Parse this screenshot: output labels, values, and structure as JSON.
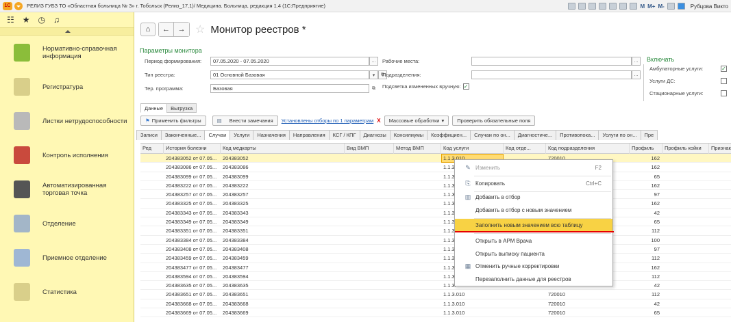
{
  "titlebar": {
    "logo": "1С",
    "title": "РЕЛИЗ ГУБЗ ТО «Областная больница № 3» г. Тобольск (Релиз_17,1)/ Медицина. Больница, редакция 1.4  (1С:Предприятие)",
    "m1": "M",
    "m2": "M+",
    "m3": "M-",
    "user": "Рубцова Викто"
  },
  "sidebar": {
    "items": [
      {
        "label": "Нормативно-справочная информация",
        "color": "#8bbd3a"
      },
      {
        "label": "Регистратура",
        "color": "#d9cf8a"
      },
      {
        "label": "Листки нетрудоспособности",
        "color": "#b9b9b9"
      },
      {
        "label": "Контроль исполнения",
        "color": "#c94a3d"
      },
      {
        "label": "Автоматизированная торговая точка",
        "color": "#555555"
      },
      {
        "label": "Отделение",
        "color": "#a3b6c8"
      },
      {
        "label": "Приемное отделение",
        "color": "#9fb7d4"
      },
      {
        "label": "Статистика",
        "color": "#d9cf8a"
      }
    ]
  },
  "header": {
    "title": "Монитор реестров *"
  },
  "params": {
    "caption": "Параметры монитора",
    "period_label": "Период формирования:",
    "period_value": "07.05.2020 - 07.05.2020",
    "type_label": "Тип реестра:",
    "type_value": "01 Основной Базовая",
    "program_label": "Тер. программа:",
    "program_value": "Базовая",
    "workplaces_label": "Рабочие места:",
    "divisions_label": "Подразделения:",
    "highlight_label": "Подсветка измененных вручную:",
    "dots": "..."
  },
  "include": {
    "caption": "Включать",
    "amb": "Амбулаторные услуги:",
    "ds": "Услуги ДС:",
    "stac": "Стационарные услуги:"
  },
  "tabs": {
    "data": "Данные",
    "export": "Выгрузка"
  },
  "toolbar": {
    "apply": "Применить фильтры",
    "remarks": "Внести замечания",
    "filter_link": "Установлены отборы по 1 параметрам",
    "x": "X",
    "mass": "Массовые обработки",
    "check": "Проверить обязательные поля"
  },
  "subtabs": [
    "Записи",
    "Законченные...",
    "Случаи",
    "Услуги",
    "Назначения",
    "Направления",
    "КСГ / КПГ",
    "Диагнозы",
    "Консилиумы",
    "Коэффициен...",
    "Случаи по он...",
    "Диагностиче...",
    "Противопока...",
    "Услуги по он...",
    "Пре"
  ],
  "columns": [
    "Ред",
    "История болезни",
    "Код медкарты",
    "Вид ВМП",
    "Метод ВМП",
    "Код услуги",
    "Код отде...",
    "Код подразделения",
    "Профиль",
    "Профиль койки",
    "Признак"
  ],
  "rows": [
    [
      "204383052 от 07.05...",
      "204383052",
      "1.1.3.010",
      "720010",
      "162"
    ],
    [
      "204383086 от 07.05...",
      "204383086",
      "1.1.3.",
      "",
      "162"
    ],
    [
      "204383099 от 07.05...",
      "204383099",
      "1.1.3.",
      "",
      "65"
    ],
    [
      "204383222 от 07.05...",
      "204383222",
      "1.1.3.",
      "",
      "162"
    ],
    [
      "204383257 от 07.05...",
      "204383257",
      "1.1.3.",
      "",
      "97"
    ],
    [
      "204383325 от 07.05...",
      "204383325",
      "1.1.3.",
      "",
      "162"
    ],
    [
      "204383343 от 07.05...",
      "204383343",
      "1.1.3.",
      "",
      "42"
    ],
    [
      "204383349 от 07.05...",
      "204383349",
      "1.1.3.",
      "",
      "65"
    ],
    [
      "204383351 от 07.05...",
      "204383351",
      "1.1.3.",
      "",
      "112"
    ],
    [
      "204383384 от 07.05...",
      "204383384",
      "1.1.3.",
      "",
      "100"
    ],
    [
      "204383408 от 07.05...",
      "204383408",
      "1.1.3.",
      "",
      "97"
    ],
    [
      "204383459 от 07.05...",
      "204383459",
      "1.1.3.",
      "",
      "112"
    ],
    [
      "204383477 от 07.05...",
      "204383477",
      "1.1.3.",
      "",
      "162"
    ],
    [
      "204383594 от 07.05...",
      "204383594",
      "1.1.3.",
      "",
      "112"
    ],
    [
      "204383635 от 07.05...",
      "204383635",
      "1.1.3.",
      "",
      "42"
    ],
    [
      "204383651 от 07.05...",
      "204383651",
      "1.1.3.010",
      "720010",
      "112"
    ],
    [
      "204383668 от 07.05...",
      "204383668",
      "1.1.3.010",
      "720010",
      "42"
    ],
    [
      "204383669 от 07.05...",
      "204383669",
      "1.1.3.010",
      "720010",
      "65"
    ]
  ],
  "context_menu": {
    "edit": "Изменить",
    "edit_sc": "F2",
    "copy": "Копировать",
    "copy_sc": "Ctrl+C",
    "add_filter": "Добавить в отбор",
    "add_filter_new": "Добавить в отбор с новым значением",
    "fill_all": "Заполнить новым значением всю таблицу",
    "open_arm": "Открыть в АРМ Врача",
    "open_extract": "Открыть выписку пациента",
    "cancel_manual": "Отменить ручные корректировки",
    "refill": "Перезаполнить данные для реестров"
  }
}
